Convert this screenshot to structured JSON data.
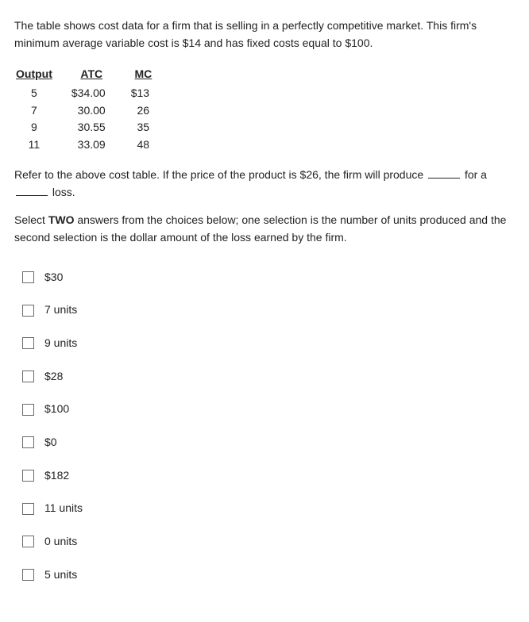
{
  "intro": "The table shows cost data for a firm that is selling in a perfectly competitive market. This firm's minimum average variable cost is $14 and has fixed costs equal to $100.",
  "headers": {
    "output": "Output",
    "atc": "ATC",
    "mc": "MC"
  },
  "rows": [
    {
      "output": "5",
      "atc": "$34.00",
      "mc": "$13"
    },
    {
      "output": "7",
      "atc": "30.00",
      "mc": "26"
    },
    {
      "output": "9",
      "atc": "30.55",
      "mc": "35"
    },
    {
      "output": "11",
      "atc": "33.09",
      "mc": "48"
    }
  ],
  "q": {
    "pre": "Refer to the above cost table. If the price of the product is $26, the firm will produce ",
    "mid": " for a ",
    "post": " loss."
  },
  "instr_pre": "Select ",
  "instr_bold": "TWO",
  "instr_post": " answers from the choices below; one selection is the number of units produced and the second selection is the dollar amount of the loss earned by the firm.",
  "choices": [
    "$30",
    "7 units",
    "9 units",
    "$28",
    "$100",
    "$0",
    "$182",
    "11 units",
    "0 units",
    "5 units"
  ]
}
